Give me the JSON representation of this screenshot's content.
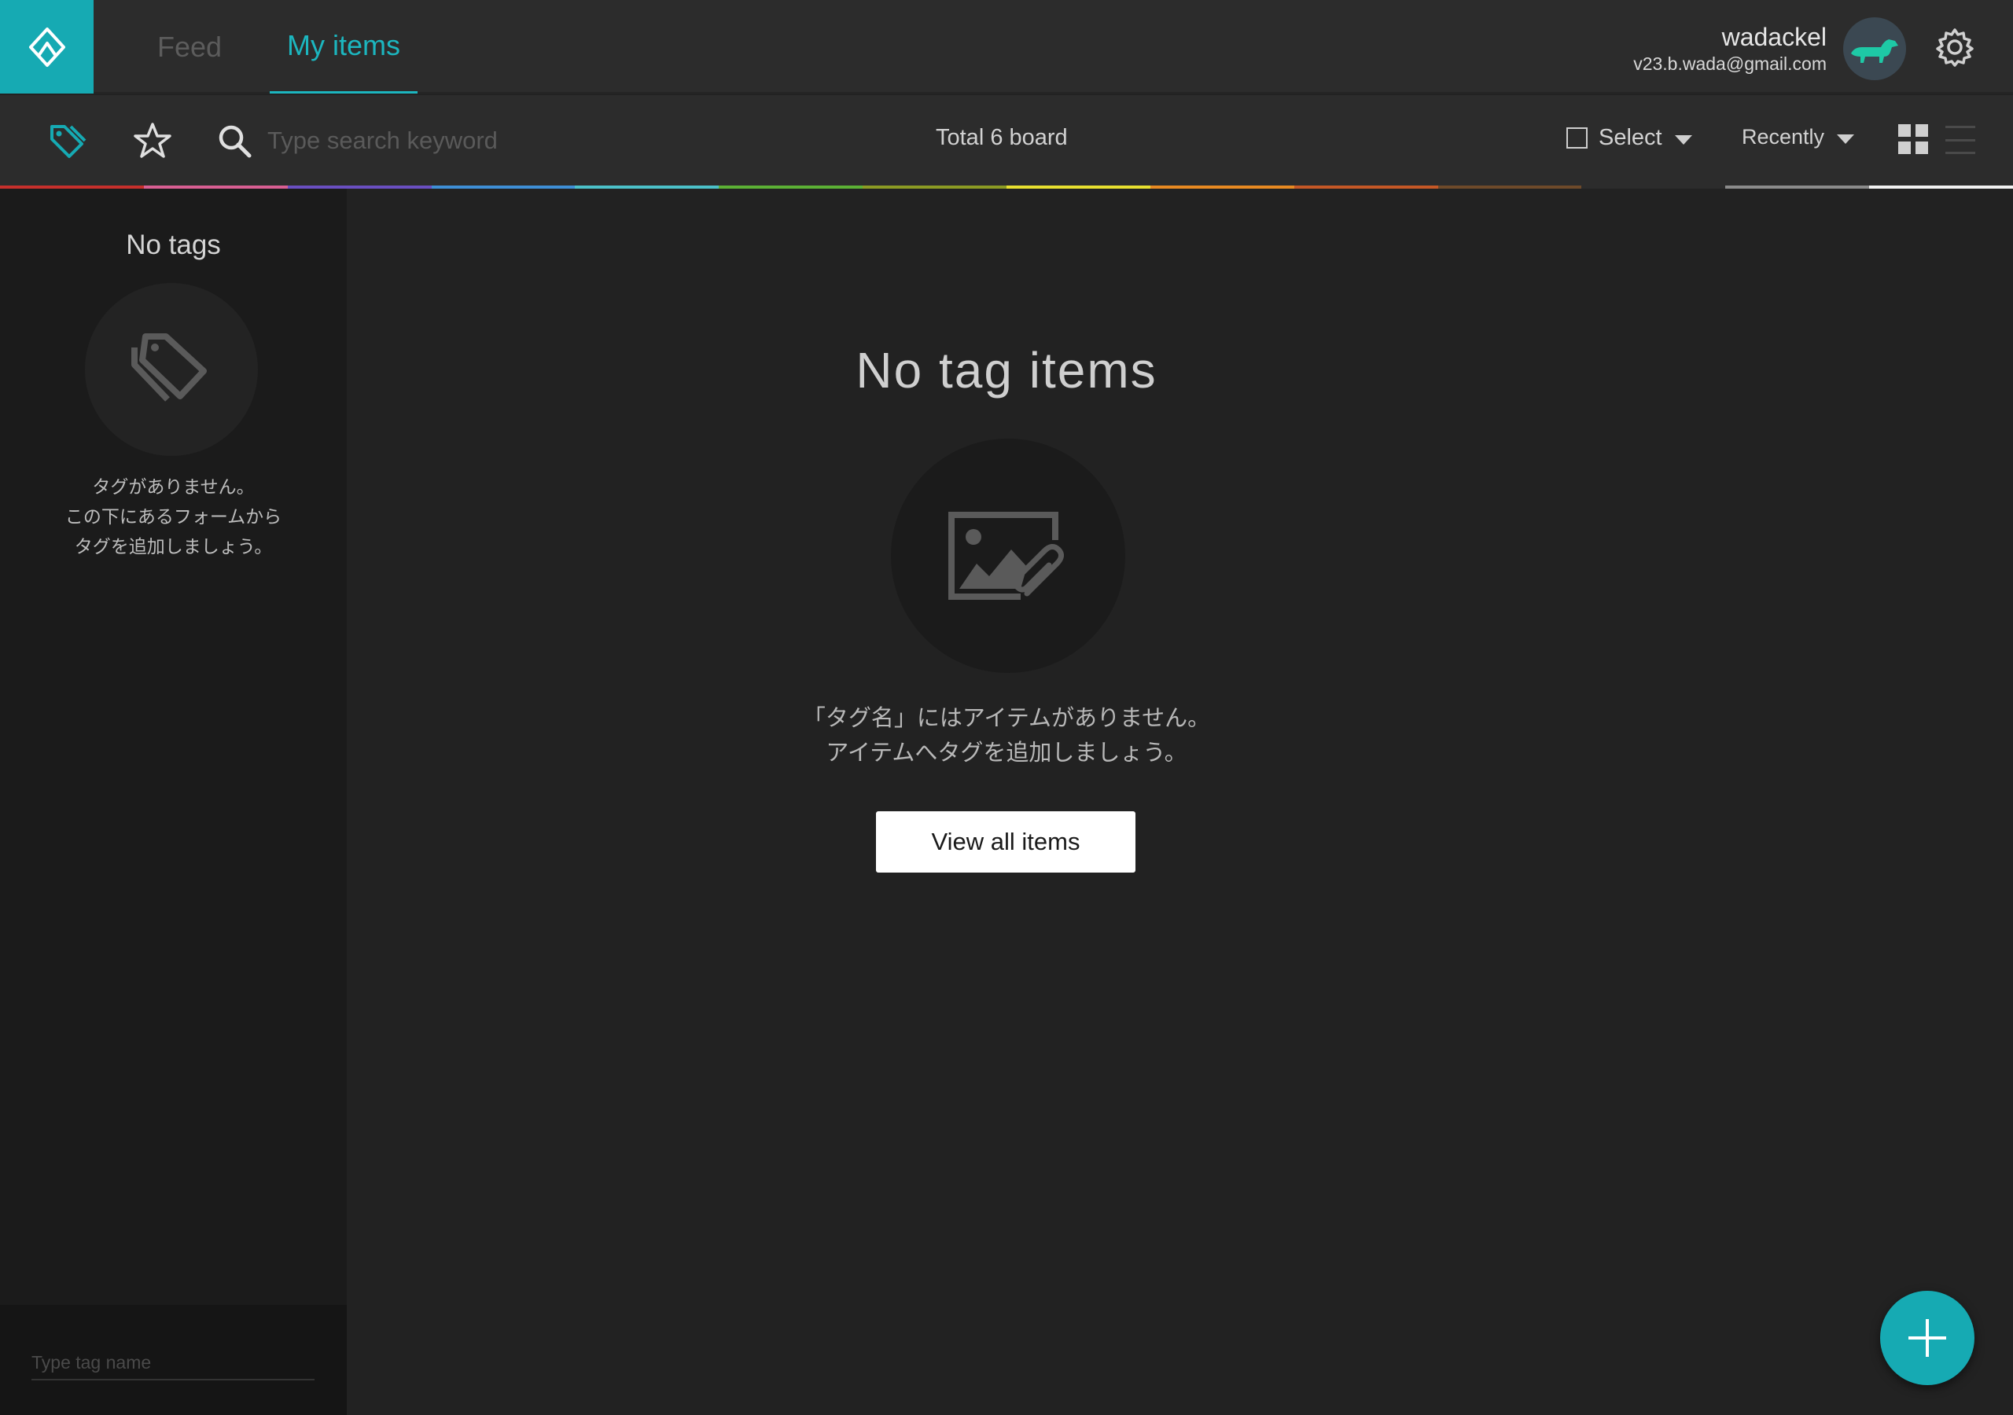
{
  "nav": {
    "feed": "Feed",
    "my_items": "My items"
  },
  "user": {
    "name": "wadackel",
    "email": "v23.b.wada@gmail.com"
  },
  "toolbar": {
    "search_placeholder": "Type search keyword",
    "total": "Total 6 board",
    "select_label": "Select",
    "sort_label": "Recently"
  },
  "sidebar": {
    "title": "No tags",
    "message_lines": [
      "タグがありません。",
      "この下にあるフォームから",
      "タグを追加しましょう。"
    ],
    "tag_input_placeholder": "Type tag name"
  },
  "main": {
    "title": "No tag items",
    "message_lines": [
      "「タグ名」にはアイテムがありません。",
      "アイテムへタグを追加しましょう。"
    ],
    "view_all_button": "View all items"
  },
  "colors": {
    "accent": "#16aab3",
    "strip": [
      "#c7302c",
      "#d95f93",
      "#6a4fc1",
      "#3f8fd6",
      "#4cc1c9",
      "#5cb135",
      "#8c9b24",
      "#e8e030",
      "#e88a22",
      "#c55826",
      "#6e4a2a",
      "#2c2c2c",
      "#8b8b8b",
      "#f2f2f2"
    ]
  },
  "icons": {
    "logo": "diamond-logo-icon",
    "tag": "tag-icon",
    "star": "star-icon",
    "search": "search-icon",
    "settings": "gear-icon",
    "grid": "grid-view-icon",
    "list": "list-view-icon",
    "empty_tags": "tags-icon",
    "empty_items": "image-attachment-icon",
    "add": "plus-icon"
  }
}
